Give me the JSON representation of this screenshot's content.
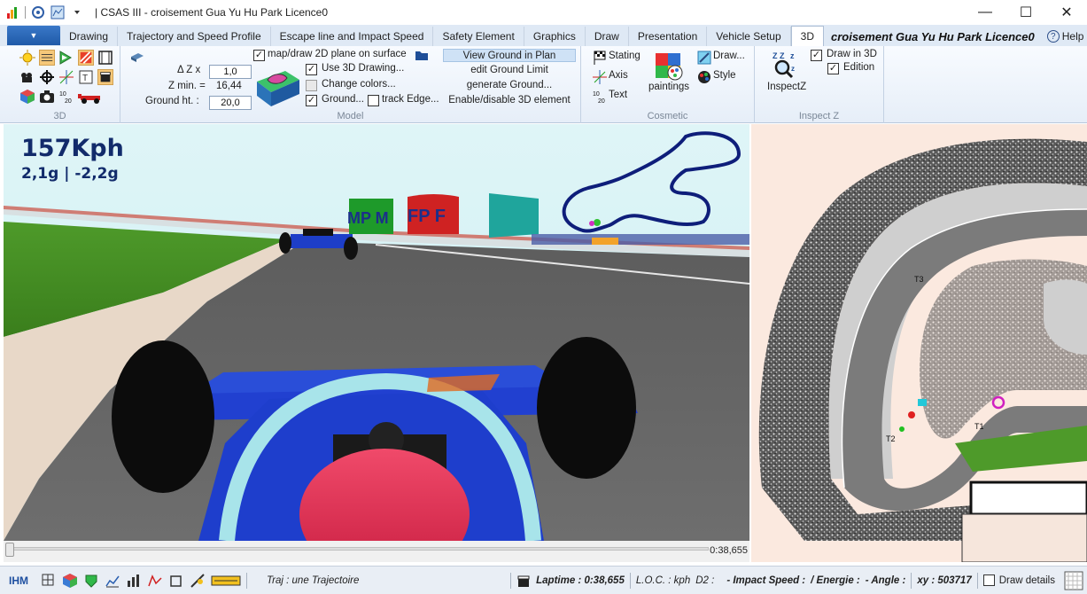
{
  "window": {
    "title": "| CSAS III - croisement Gua Yu Hu Park Licence0",
    "minimize": "—",
    "maximize": "☐",
    "close": "✕"
  },
  "ribbon": {
    "file_button": "▼",
    "tabs": [
      {
        "label": "Drawing"
      },
      {
        "label": "Trajectory and Speed Profile"
      },
      {
        "label": "Escape line and Impact Speed"
      },
      {
        "label": "Safety Element"
      },
      {
        "label": "Graphics"
      },
      {
        "label": "Draw"
      },
      {
        "label": "Presentation"
      },
      {
        "label": "Vehicle Setup"
      },
      {
        "label": "3D"
      }
    ],
    "active_tab": "3D",
    "document_title": "croisement Gua Yu Hu Park Licence0",
    "help_label": "Help",
    "groups": {
      "g3d": {
        "label": "3D"
      },
      "model": {
        "label": "Model",
        "dz_label": "Δ Z x",
        "dz_value": "1,0",
        "zmin_label": "Z min. =",
        "zmin_value": "16,44",
        "ground_ht_label": "Ground ht. :",
        "ground_ht_value": "20,0",
        "map_draw_label": "map/draw 2D plane on surface",
        "use3d_label": "Use 3D Drawing...",
        "change_colors_label": "Change colors...",
        "ground_label": "Ground...",
        "track_edge_label": "track Edge...",
        "view_ground_label": "View Ground in Plan",
        "edit_ground_label": "edit Ground Limit",
        "generate_ground_label": "generate Ground...",
        "enable_3d_label": "Enable/disable 3D element"
      },
      "cosmetic": {
        "label": "Cosmetic",
        "stating_label": "Stating",
        "axis_label": "Axis",
        "text_label": "Text",
        "paintings_label": "paintings",
        "draw_label": "Draw...",
        "style_label": "Style"
      },
      "inspectz": {
        "label": "Inspect Z",
        "button_label": "InspectZ",
        "draw3d_label": "Draw in 3D",
        "edition_label": "Edition"
      }
    }
  },
  "view3d": {
    "speed": "157Kph",
    "gforce": "2,1g | -2,2g",
    "billboards": [
      "MP M",
      "FP F"
    ]
  },
  "timeline": {
    "position": 0.0,
    "time": "0:38,655"
  },
  "plan": {
    "labels": [
      "T3",
      "T2",
      "T1"
    ]
  },
  "statusbar": {
    "ihm": "IHM",
    "traj": "Traj : une Trajectoire",
    "laptime": "Laptime : 0:38,655",
    "loc": "L.O.C. : kph",
    "d2": "D2 :",
    "impact": "- Impact Speed :",
    "energie": "/ Energie :",
    "angle": "- Angle :",
    "xy": "xy : 503717",
    "draw_details": "Draw details"
  },
  "colors": {
    "ribbon_bg": "#e6eef8",
    "tab_bar": "#dfe9f5",
    "accent": "#1f5aa8",
    "speed_text": "#122b6b",
    "car_blue": "#1f3fd6",
    "halo": "#a8e4ea",
    "helmet": "#e8274d"
  }
}
